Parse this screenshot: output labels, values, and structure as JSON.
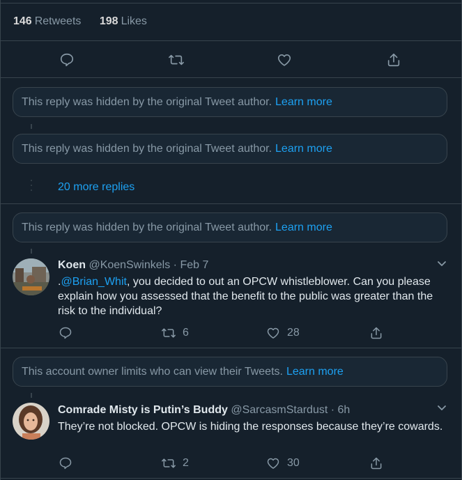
{
  "stats": {
    "retweets_count": "146",
    "retweets_label": "Retweets",
    "likes_count": "198",
    "likes_label": "Likes"
  },
  "hidden_replies": [
    {
      "text": "This reply was hidden by the original Tweet author.",
      "link": "Learn more"
    },
    {
      "text": "This reply was hidden by the original Tweet author.",
      "link": "Learn more"
    },
    {
      "text": "This reply was hidden by the original Tweet author.",
      "link": "Learn more"
    }
  ],
  "more_replies": "20 more replies",
  "tweets": [
    {
      "name": "Koen",
      "handle": "@KoenSwinkels",
      "separator": "·",
      "date": "Feb 7",
      "text_prefix": ".",
      "mention": "@Brian_Whit",
      "text": ", you decided to out an OPCW whistleblower. Can you please explain how you assessed that the benefit to the public was greater than the risk to the individual?",
      "retweets": "6",
      "likes": "28"
    },
    {
      "name": "Comrade Misty is Putin’s Buddy",
      "handle": "@SarcasmStardust",
      "separator": "·",
      "date": "6h",
      "text": "They’re not blocked. OPCW is hiding the responses because they’re cowards.",
      "retweets": "2",
      "likes": "30"
    }
  ],
  "limited": {
    "text": "This account owner limits who can view their Tweets.",
    "link": "Learn more"
  },
  "colors": {
    "background": "#15202b",
    "accent": "#1da1f2",
    "secondary": "#8899a6",
    "border": "#38444d"
  }
}
